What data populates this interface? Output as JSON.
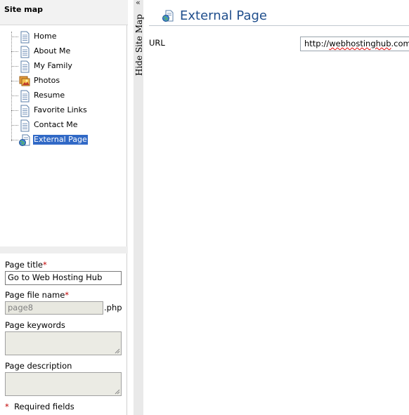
{
  "sitemap": {
    "header": "Site map",
    "items": [
      {
        "label": "Home",
        "icon": "page-icon"
      },
      {
        "label": "About Me",
        "icon": "page-icon"
      },
      {
        "label": "My Family",
        "icon": "page-icon"
      },
      {
        "label": "Photos",
        "icon": "photo-gallery-icon"
      },
      {
        "label": "Resume",
        "icon": "page-icon"
      },
      {
        "label": "Favorite Links",
        "icon": "page-icon"
      },
      {
        "label": "Contact Me",
        "icon": "page-icon"
      },
      {
        "label": "External Page",
        "icon": "external-page-icon",
        "selected": true
      }
    ]
  },
  "properties": {
    "page_title_label": "Page title",
    "page_title_value": "Go to Web Hosting Hub",
    "page_file_label": "Page file name",
    "page_file_value": "page8",
    "page_file_ext": ".php",
    "keywords_label": "Page keywords",
    "description_label": "Page description",
    "required_marker": "*",
    "required_note": "Required fields"
  },
  "splitter": {
    "collapse_glyph": "«",
    "hide_label": "Hide Site Map"
  },
  "main": {
    "title": "External Page",
    "url_label": "URL",
    "url_value_prefix": "http://",
    "url_value_word": "webhostinghub",
    "url_value_suffix": ".com"
  },
  "colors": {
    "title": "#1f4e8c",
    "selection": "#3169c6",
    "required": "#c00000"
  }
}
